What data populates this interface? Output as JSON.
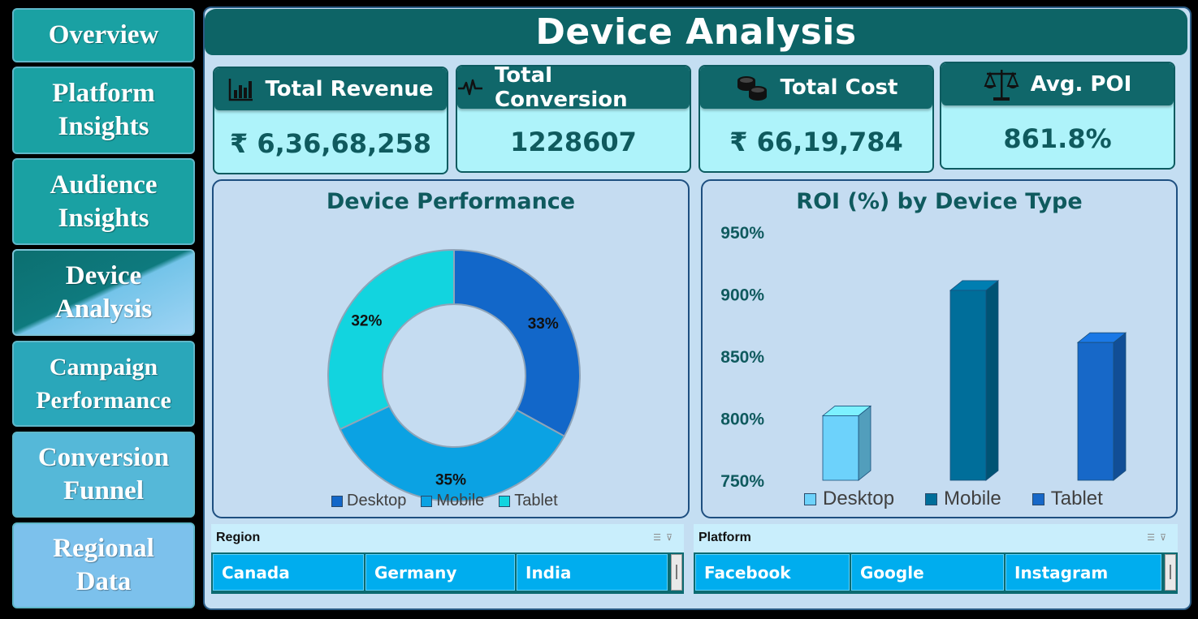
{
  "sidebar": {
    "items": [
      {
        "label": "Overview",
        "bg": "#1aa1a3"
      },
      {
        "label": "Platform Insights",
        "bg": "#1aa1a3"
      },
      {
        "label": "Audience Insights",
        "bg": "#1aa1a3"
      },
      {
        "label": "Device Analysis",
        "active": true
      },
      {
        "label": "Campaign Performance",
        "bg": "#2aa7ba"
      },
      {
        "label": "Conversion Funnel",
        "bg": "#55b8d8"
      },
      {
        "label": "Regional Data",
        "bg": "#7cc1ec"
      }
    ]
  },
  "header": {
    "title": "Device Analysis"
  },
  "kpis": [
    {
      "label": "Total Revenue",
      "value": "₹ 6,36,68,258",
      "icon": "bar-chart-icon"
    },
    {
      "label": "Total Conversion",
      "value": "1228607",
      "icon": "pulse-icon"
    },
    {
      "label": "Total Cost",
      "value": "₹ 66,19,784",
      "icon": "coins-icon"
    },
    {
      "label": "Avg. POI",
      "value": "861.8%",
      "icon": "scales-icon"
    }
  ],
  "chart_data": [
    {
      "type": "pie",
      "title": "Device Performance",
      "categories": [
        "Desktop",
        "Mobile",
        "Tablet"
      ],
      "values": [
        33,
        35,
        32
      ],
      "labels": [
        "33%",
        "35%",
        "32%"
      ],
      "colors": [
        "#1267c9",
        "#0ba2e3",
        "#12d4df"
      ],
      "legend": "bottom"
    },
    {
      "type": "bar",
      "title": "ROI (%) by Device Type",
      "categories": [
        "Desktop",
        "Mobile",
        "Tablet"
      ],
      "values": [
        802,
        903,
        861
      ],
      "ylim": [
        750,
        950
      ],
      "yticks": [
        "950%",
        "900%",
        "850%",
        "800%",
        "750%"
      ],
      "colors": [
        "#6dd2fb",
        "#006e9a",
        "#1768c8"
      ],
      "legend": "bottom"
    }
  ],
  "slicers": {
    "region": {
      "title": "Region",
      "options": [
        "Canada",
        "Germany",
        "India"
      ]
    },
    "platform": {
      "title": "Platform",
      "options": [
        "Facebook",
        "Google",
        "Instagram"
      ]
    }
  }
}
